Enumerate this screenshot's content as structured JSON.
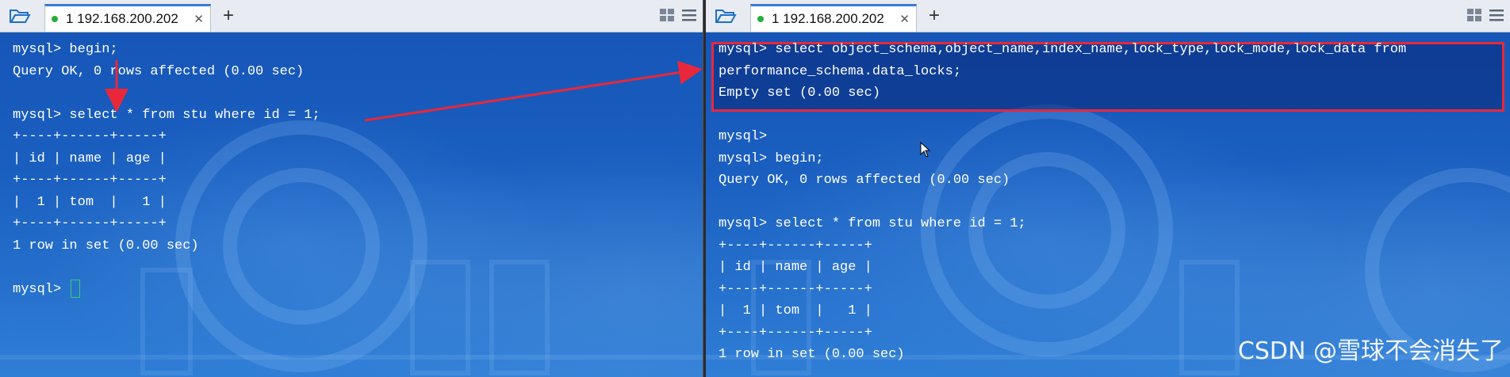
{
  "left": {
    "tab_title": "1 192.168.200.202",
    "tab_close": "✕",
    "add_tab": "+",
    "lines": [
      "mysql> begin;",
      "Query OK, 0 rows affected (0.00 sec)",
      "",
      "mysql> select * from stu where id = 1;",
      "+----+------+-----+",
      "| id | name | age |",
      "+----+------+-----+",
      "|  1 | tom  |   1 |",
      "+----+------+-----+",
      "1 row in set (0.00 sec)",
      "",
      "mysql> "
    ]
  },
  "right": {
    "tab_title": "1 192.168.200.202",
    "tab_close": "✕",
    "add_tab": "+",
    "lines": [
      "mysql> select object_schema,object_name,index_name,lock_type,lock_mode,lock_data from",
      "performance_schema.data_locks;",
      "Empty set (0.00 sec)",
      "",
      "mysql>",
      "mysql> begin;",
      "Query OK, 0 rows affected (0.00 sec)",
      "",
      "mysql> select * from stu where id = 1;",
      "+----+------+-----+",
      "| id | name | age |",
      "+----+------+-----+",
      "|  1 | tom  |   1 |",
      "+----+------+-----+",
      "1 row in set (0.00 sec)"
    ]
  },
  "watermark": "CSDN @雪球不会消失了",
  "colors": {
    "terminal_bg": "#1a5fc0",
    "annotation_red": "#e8283a",
    "cursor_green": "#2fd16b",
    "tab_dot_green": "#27ae3e"
  },
  "icons": [
    "folder-open-icon",
    "layout-grid-icon",
    "hamburger-menu-icon",
    "mouse-pointer-icon"
  ]
}
